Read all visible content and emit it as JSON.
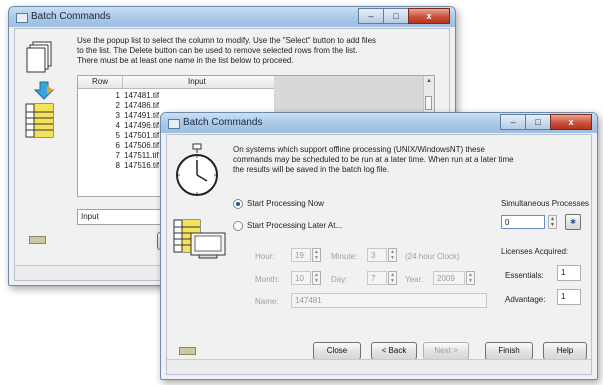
{
  "back_window": {
    "title": "Batch Commands",
    "caption_buttons": [
      "–",
      "□",
      "x"
    ],
    "instructions": "Use the popup list to select the column to modify. Use the \"Select\" button to add files to the list. The Delete button can be used to remove selected rows from the list. There must be at least one name in the list below to proceed.",
    "table": {
      "headers": [
        "Row",
        "Input"
      ],
      "rows": [
        {
          "row": "1",
          "input": "147481.tif"
        },
        {
          "row": "2",
          "input": "147486.tif"
        },
        {
          "row": "3",
          "input": "147491.tif"
        },
        {
          "row": "4",
          "input": "147496.tif"
        },
        {
          "row": "5",
          "input": "147501.tif"
        },
        {
          "row": "6",
          "input": "147506.tif"
        },
        {
          "row": "7",
          "input": "147511.tif"
        },
        {
          "row": "8",
          "input": "147516.tif"
        }
      ]
    },
    "column_select": "Input"
  },
  "front_window": {
    "title": "Batch Commands",
    "caption_buttons": [
      "–",
      "□",
      "x"
    ],
    "description": "On systems which support offline processing (UNIX/WindowsNT) these commands may be scheduled to be run at a later time. When run at a later time the results will be saved in the batch log file.",
    "start_now_label": "Start Processing Now",
    "start_later_label": "Start Processing Later At...",
    "hour_label": "Hour:",
    "hour_value": "19",
    "minute_label": "Minute:",
    "minute_value": "3",
    "clock_note": "(24 hour Clock)",
    "month_label": "Month:",
    "month_value": "10",
    "day_label": "Day:",
    "day_value": "7",
    "year_label": "Year:",
    "year_value": "2009",
    "name_label": "Name:",
    "name_value": "147481",
    "simultaneous_label": "Simultaneous Processes",
    "simultaneous_value": "0",
    "licenses_label": "Licenses Acquired:",
    "essentials_label": "Essentials:",
    "essentials_value": "1",
    "advantage_label": "Advantage:",
    "advantage_value": "1",
    "buttons": {
      "close": "Close",
      "back": "< Back",
      "next": "Next >",
      "finish": "Finish",
      "help": "Help"
    }
  }
}
